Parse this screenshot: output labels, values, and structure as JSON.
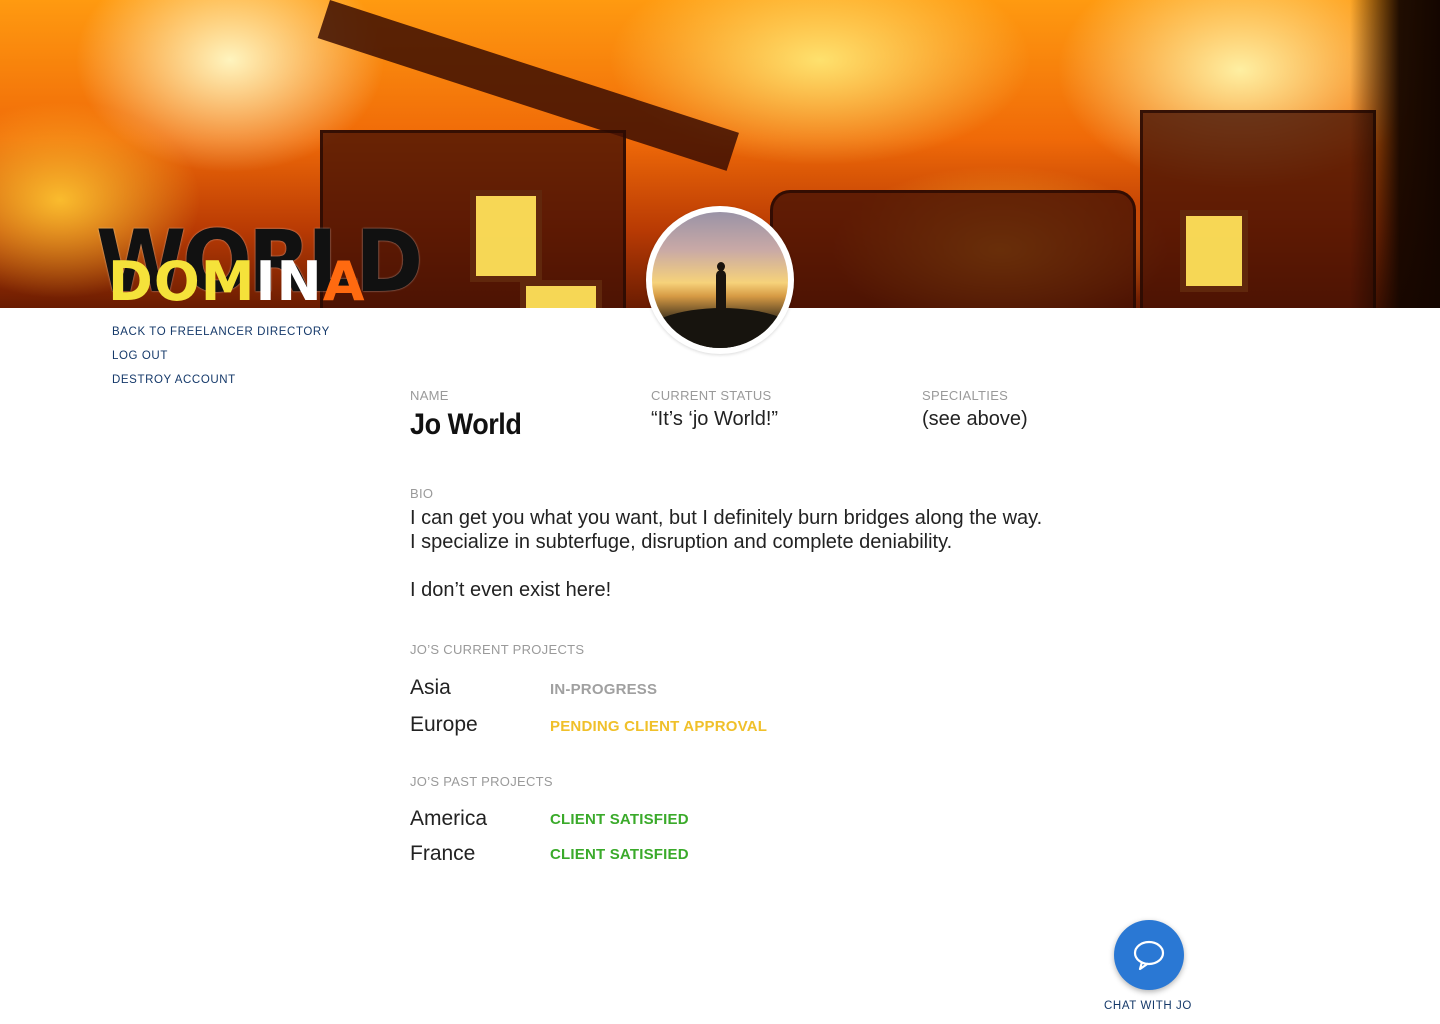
{
  "logo": {
    "line1": "WORLD",
    "line2_part1": "DOM",
    "line2_part2": "IN",
    "line2_part3": "A"
  },
  "nav": {
    "items": [
      {
        "label": "BACK TO FREELANCER DIRECTORY"
      },
      {
        "label": "LOG OUT"
      },
      {
        "label": "DESTROY ACCOUNT"
      }
    ]
  },
  "profile": {
    "name_label": "NAME",
    "name": "Jo World",
    "status_label": "CURRENT STATUS",
    "status": "“It’s ‘jo World!”",
    "specialties_label": "SPECIALTIES",
    "specialties": "(see above)",
    "bio_label": "BIO",
    "bio_paragraphs": [
      "I can get you what you want, but I definitely burn bridges along the way. I specialize in subterfuge, disruption and complete deniability.",
      "I don’t even exist here!"
    ]
  },
  "current_projects": {
    "heading": "JO’S CURRENT PROJECTS",
    "items": [
      {
        "name": "Asia",
        "status": "IN-PROGRESS",
        "status_color": "#a0a0a0"
      },
      {
        "name": "Europe",
        "status": "PENDING CLIENT APPROVAL",
        "status_color": "#f0c02a"
      }
    ]
  },
  "past_projects": {
    "heading": "JO’S PAST PROJECTS",
    "items": [
      {
        "name": "America",
        "status": "CLIENT SATISFIED",
        "status_color": "#3aaa2a"
      },
      {
        "name": "France",
        "status": "CLIENT SATISFIED",
        "status_color": "#3aaa2a"
      }
    ]
  },
  "chat": {
    "label": "CHAT WITH JO",
    "icon": "chat-bubble-icon",
    "color": "#2a78d4"
  }
}
